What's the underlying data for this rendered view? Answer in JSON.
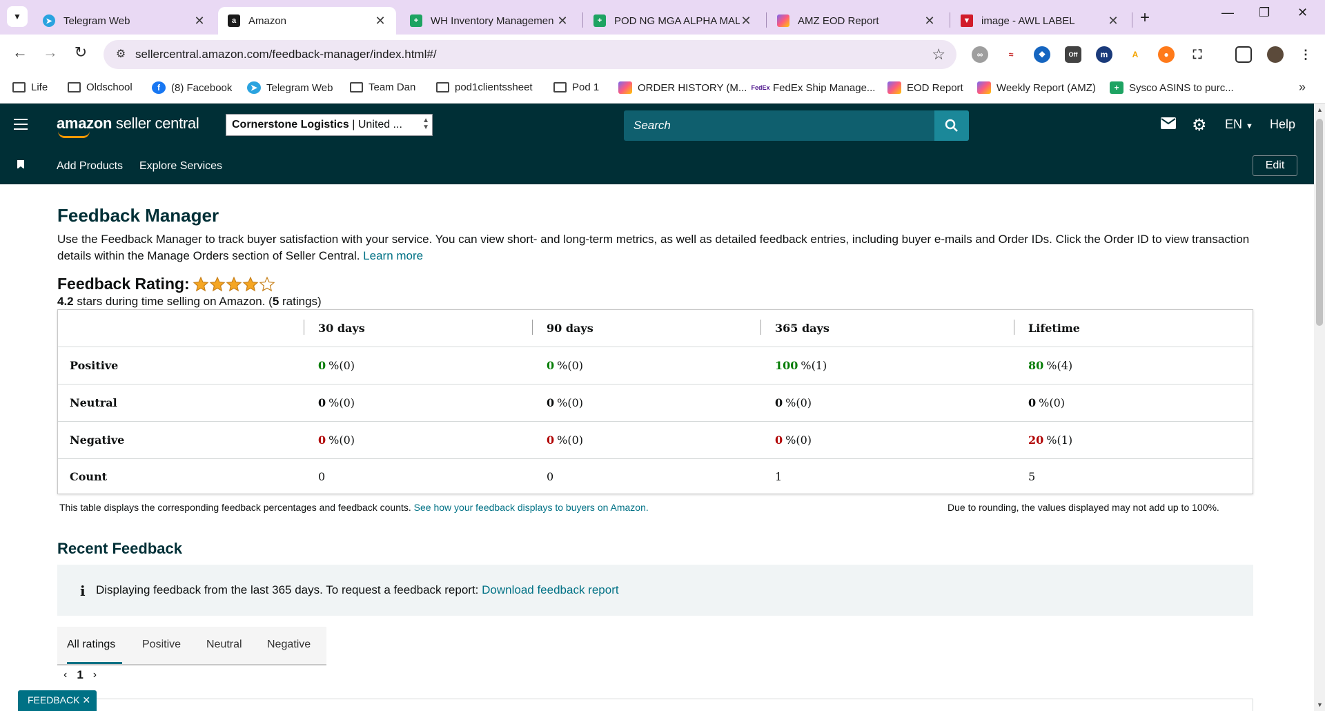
{
  "browser": {
    "tabs": [
      {
        "title": "Telegram Web",
        "icon": "telegram-icon",
        "active": false
      },
      {
        "title": "Amazon",
        "icon": "amazon-a-icon",
        "active": true
      },
      {
        "title": "WH Inventory Managemen",
        "icon": "sheets-icon",
        "active": false
      },
      {
        "title": "POD NG MGA ALPHA MAL",
        "icon": "sheets-icon",
        "active": false
      },
      {
        "title": "AMZ EOD Report",
        "icon": "clickup-icon",
        "active": false
      },
      {
        "title": "image - AWL LABEL",
        "icon": "vivaldi-icon",
        "active": false
      }
    ],
    "url": "sellercentral.amazon.com/feedback-manager/index.html#/",
    "bookmarks": [
      {
        "label": "Life",
        "icon": "folder-icon"
      },
      {
        "label": "Oldschool",
        "icon": "folder-icon"
      },
      {
        "label": "(8) Facebook",
        "icon": "facebook-icon"
      },
      {
        "label": "Telegram Web",
        "icon": "telegram-icon"
      },
      {
        "label": "Team Dan",
        "icon": "folder-icon"
      },
      {
        "label": "pod1clientssheet",
        "icon": "folder-icon"
      },
      {
        "label": "Pod 1",
        "icon": "folder-icon"
      },
      {
        "label": "ORDER HISTORY (M...",
        "icon": "clickup-icon"
      },
      {
        "label": "FedEx Ship Manage...",
        "icon": "fedex-icon"
      },
      {
        "label": "EOD Report",
        "icon": "clickup-icon"
      },
      {
        "label": "Weekly Report (AMZ)",
        "icon": "clickup-icon"
      },
      {
        "label": "Sysco ASINS to purc...",
        "icon": "sheets-icon"
      }
    ]
  },
  "header": {
    "logo_bold": "amazon",
    "logo_rest": " seller central",
    "account_bold": "Cornerstone Logistics",
    "account_rest": " | United ...",
    "search_placeholder": "Search",
    "language": "EN",
    "help": "Help"
  },
  "subnav": {
    "add_products": "Add Products",
    "explore_services": "Explore Services",
    "edit": "Edit"
  },
  "page": {
    "title": "Feedback Manager",
    "intro": "Use the Feedback Manager to track buyer satisfaction with your service. You can view short- and long-term metrics, as well as detailed feedback entries, including buyer e-mails and Order IDs. Click the Order ID to view transaction details within the Manage Orders section of Seller Central. ",
    "learn_more": "Learn more"
  },
  "rating": {
    "title": "Feedback Rating:",
    "stars_filled": 4,
    "stars_total": 5,
    "value": "4.2",
    "text_mid": " stars during time selling on Amazon. (",
    "count": "5",
    "text_end": " ratings)"
  },
  "table": {
    "headers": [
      "30 days",
      "90 days",
      "365 days",
      "Lifetime"
    ],
    "rows": [
      {
        "label": "Positive",
        "kind": "pos",
        "cells": [
          {
            "pct": "0",
            "rest": "%(0)"
          },
          {
            "pct": "0",
            "rest": "%(0)"
          },
          {
            "pct": "100",
            "rest": "%(1)"
          },
          {
            "pct": "80",
            "rest": "%(4)"
          }
        ]
      },
      {
        "label": "Neutral",
        "kind": "neu",
        "cells": [
          {
            "pct": "0",
            "rest": "%(0)"
          },
          {
            "pct": "0",
            "rest": "%(0)"
          },
          {
            "pct": "0",
            "rest": "%(0)"
          },
          {
            "pct": "0",
            "rest": "%(0)"
          }
        ]
      },
      {
        "label": "Negative",
        "kind": "neg",
        "cells": [
          {
            "pct": "0",
            "rest": "%(0)"
          },
          {
            "pct": "0",
            "rest": "%(0)"
          },
          {
            "pct": "0",
            "rest": "%(0)"
          },
          {
            "pct": "20",
            "rest": "%(1)"
          }
        ]
      },
      {
        "label": "Count",
        "kind": "count",
        "cells": [
          {
            "pct": "",
            "rest": "0"
          },
          {
            "pct": "",
            "rest": "0"
          },
          {
            "pct": "",
            "rest": "1"
          },
          {
            "pct": "",
            "rest": "5"
          }
        ]
      }
    ],
    "note": "This table displays the corresponding feedback percentages and feedback counts. ",
    "note_link": "See how your feedback displays to buyers on Amazon.",
    "rounding_note": "Due to rounding, the values displayed may not add up to 100%."
  },
  "recent": {
    "title": "Recent Feedback",
    "info_text": "Displaying feedback from the last 365 days. To request a feedback report: ",
    "info_link": "Download feedback report",
    "tabs": [
      "All ratings",
      "Positive",
      "Neutral",
      "Negative"
    ],
    "page": "1"
  },
  "feedback_widget": "FEEDBACK ✕",
  "colors": {
    "header_bg": "#002f36",
    "link": "#007185",
    "positive": "#067d06",
    "negative": "#b10505",
    "star": "#f5a623"
  }
}
